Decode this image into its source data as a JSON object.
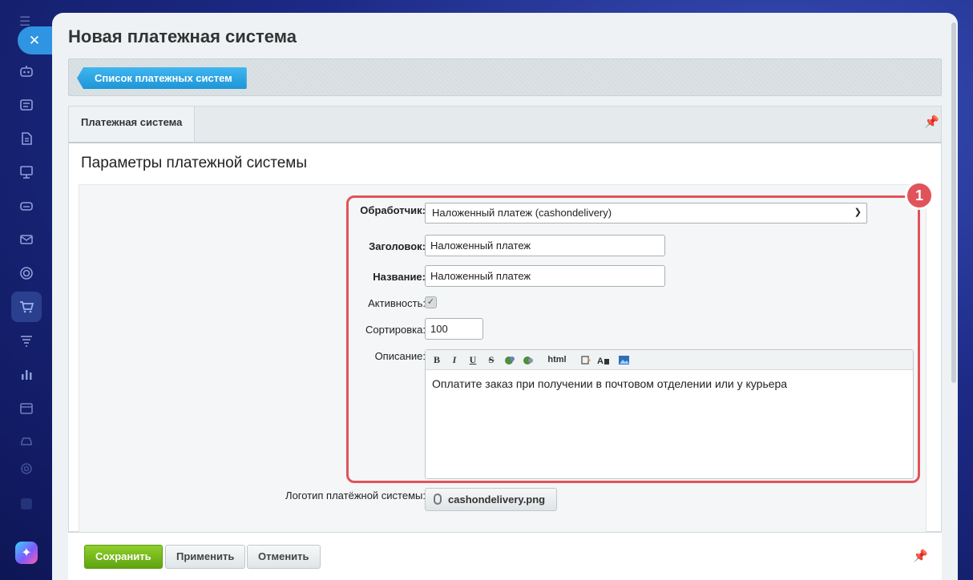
{
  "sidebar": {
    "close_symbol": "✕",
    "icons": [
      "robot-icon",
      "feed-icon",
      "document-icon",
      "presentation-icon",
      "drive-icon",
      "mail-icon",
      "settings-ring-icon",
      "cart-icon",
      "funnel-icon",
      "analytics-icon",
      "calendar-icon",
      "car-icon",
      "gear-icon",
      "square-icon"
    ],
    "ai_symbol": "✦"
  },
  "page": {
    "title": "Новая платежная система"
  },
  "toolbar": {
    "back_label": "Список платежных систем"
  },
  "tabs": [
    {
      "label": "Платежная система",
      "active": true
    }
  ],
  "section": {
    "title": "Параметры платежной системы"
  },
  "form": {
    "handler_label": "Обработчик:",
    "handler_value": "Наложенный платеж (cashondelivery)",
    "header_label": "Заголовок:",
    "header_value": "Наложенный платеж",
    "name_label": "Название:",
    "name_value": "Наложенный платеж",
    "active_label": "Активность:",
    "active_checked": true,
    "sort_label": "Сортировка:",
    "sort_value": "100",
    "description_label": "Описание:",
    "description_text": "Оплатите заказ при получении в почтовом отделении или у курьера",
    "editor_tools": [
      "B",
      "I",
      "U",
      "S",
      "html"
    ],
    "logo_label": "Логотип платёжной системы:",
    "logo_file": "cashondelivery.png"
  },
  "annotation": {
    "badge": "1",
    "color": "#e1535b"
  },
  "footer": {
    "save_label": "Сохранить",
    "apply_label": "Применить",
    "cancel_label": "Отменить"
  }
}
